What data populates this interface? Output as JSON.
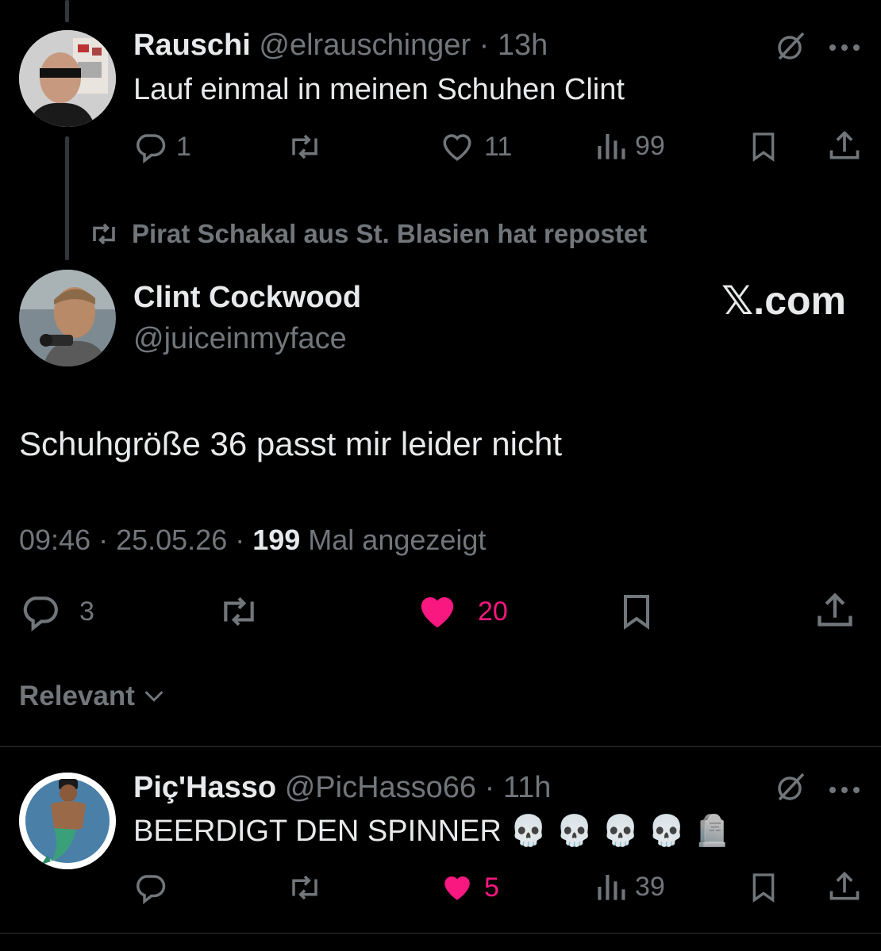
{
  "parent_tweet": {
    "name": "Rauschi",
    "handle": "@elrauschinger",
    "time": "· 13h",
    "text": "Lauf einmal in meinen Schuhen Clint",
    "replies": "1",
    "reposts": "",
    "likes": "11",
    "views": "99"
  },
  "repost_banner": "Pirat Schakal aus St. Blasien hat repostet",
  "main_tweet": {
    "name": "Clint Cockwood",
    "handle": "@juiceinmyface",
    "watermark": "𝕏.com",
    "text": "Schuhgröße 36 passt mir leider nicht",
    "timestamp": "09:46 · 25.05.26 · ",
    "views_count": "199",
    "views_label": " Mal angezeigt",
    "replies": "3",
    "likes": "20"
  },
  "sort": {
    "label": "Relevant"
  },
  "reply_tweet": {
    "name": "Piç'Hasso",
    "handle": "@PicHasso66",
    "time": "· 11h",
    "text": "BEERDIGT DEN SPINNER 💀 💀 💀 💀 🪦",
    "likes": "5",
    "views": "39"
  },
  "colors": {
    "like_pink": "#f91880",
    "muted": "#71767b",
    "background": "#000000"
  },
  "icons": [
    "reply-icon",
    "repost-icon",
    "like-icon",
    "views-icon",
    "bookmark-icon",
    "share-icon",
    "grok-icon",
    "more-icon",
    "chevron-down-icon"
  ]
}
